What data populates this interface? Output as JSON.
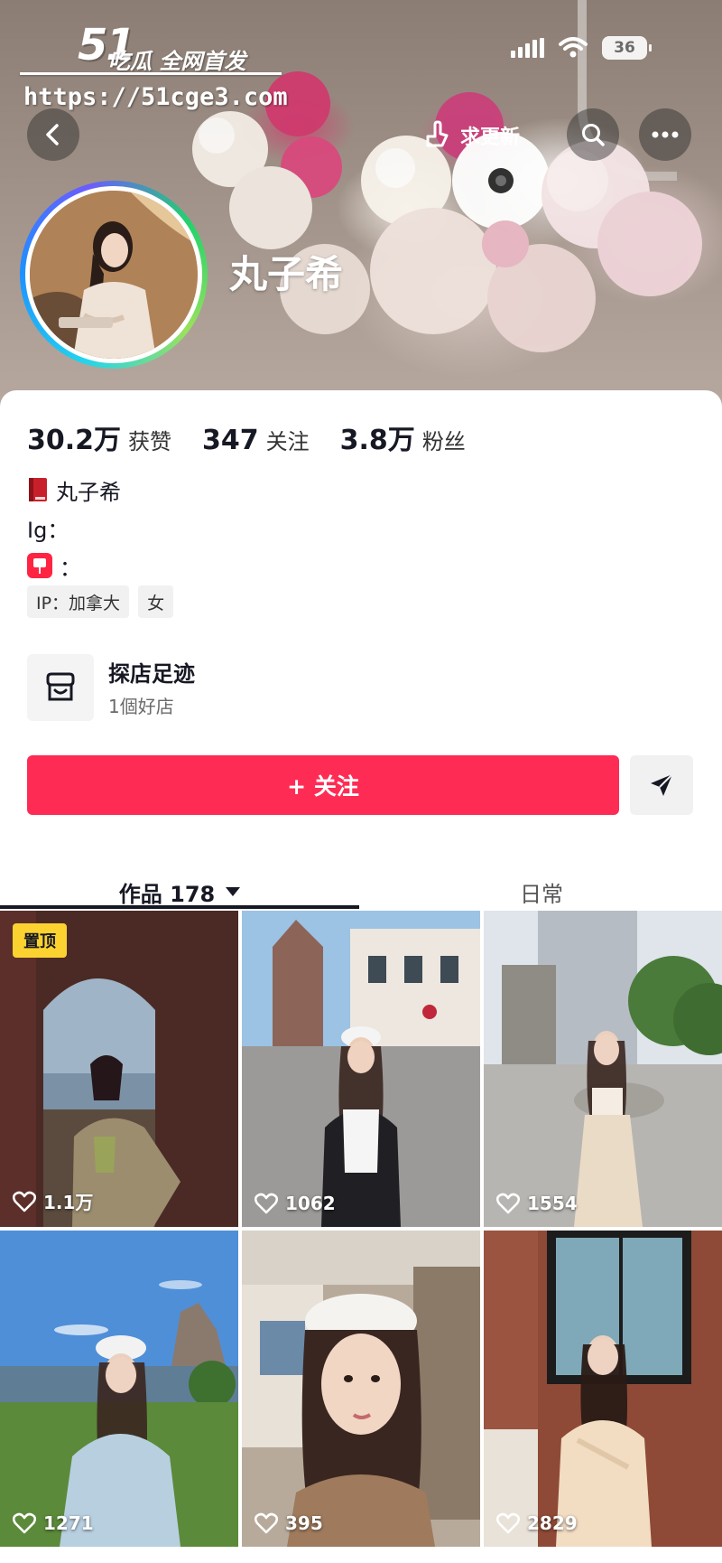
{
  "watermark": {
    "logo": "51",
    "slogan": "吃瓜 全网首发",
    "url": "https://51cge3.com"
  },
  "status_bar": {
    "battery": "36"
  },
  "header": {
    "update_label": "求更新"
  },
  "profile": {
    "nickname": "丸子希",
    "stats": [
      {
        "value": "30.2万",
        "label": "获赞"
      },
      {
        "value": "347",
        "label": "关注"
      },
      {
        "value": "3.8万",
        "label": "粉丝"
      }
    ],
    "bio": {
      "line1": "丸子希",
      "line2": "Ig：",
      "line3": "："
    },
    "tags": [
      "IP：加拿大",
      "女"
    ],
    "shop": {
      "title": "探店足迹",
      "subtitle": "1個好店"
    },
    "follow_label": "+ 关注"
  },
  "tabs": {
    "works": "作品 178",
    "daily": "日常"
  },
  "videos": [
    {
      "likes": "1.1万",
      "badge": "置顶"
    },
    {
      "likes": "1062"
    },
    {
      "likes": "1554"
    },
    {
      "likes": "1271"
    },
    {
      "likes": "395"
    },
    {
      "likes": "2829"
    }
  ],
  "colors": {
    "follow": "#fe2c55",
    "badge": "#fcd230",
    "text": "#161823"
  }
}
